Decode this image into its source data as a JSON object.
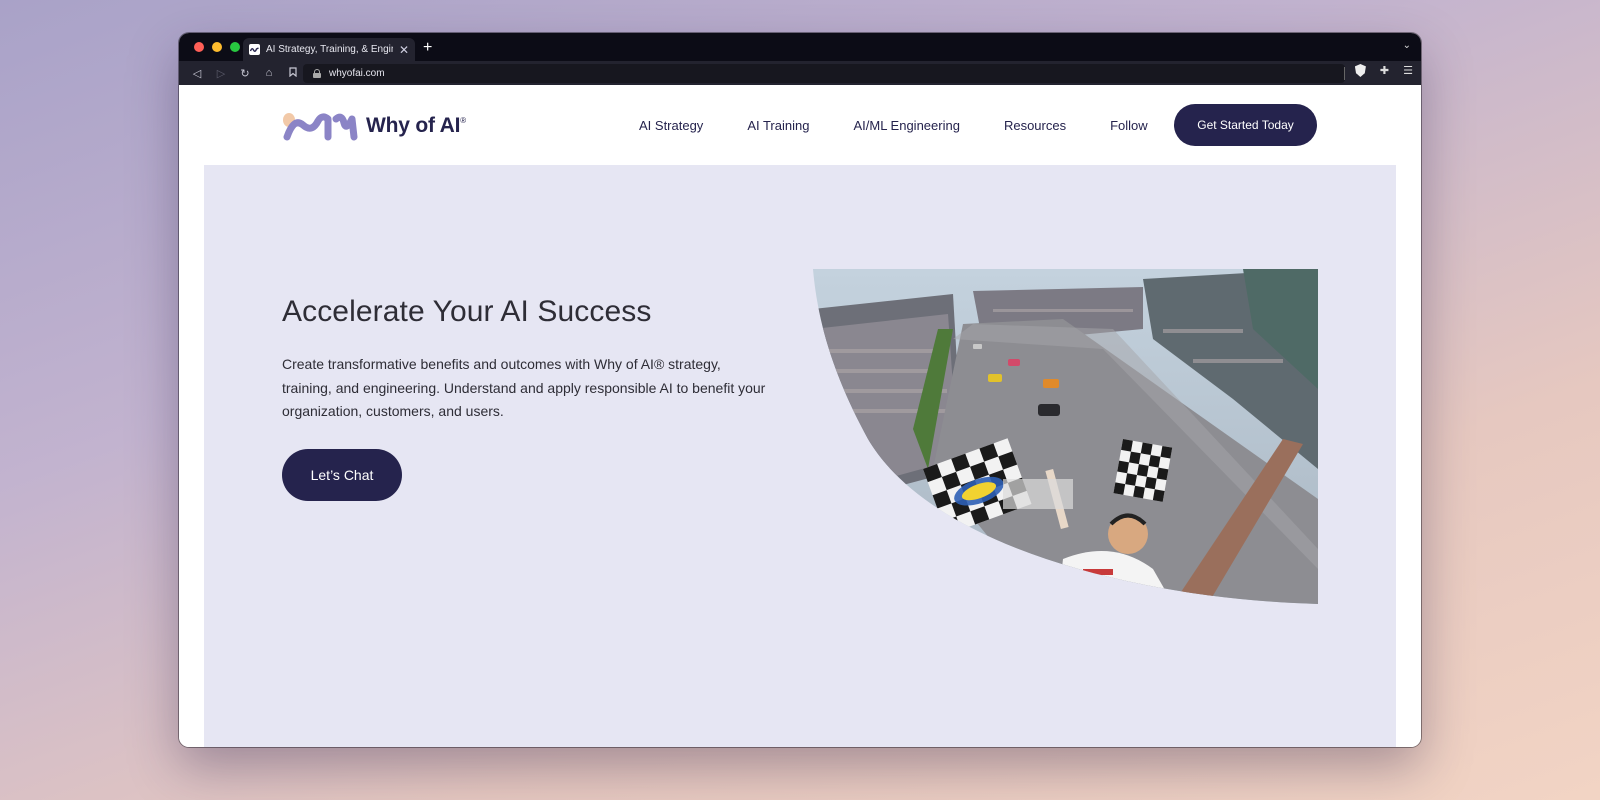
{
  "browser": {
    "tab_title": "AI Strategy, Training, & Engineering",
    "url": "whyofai.com",
    "colors": {
      "close": "#ff5f57",
      "minimize": "#febc2e",
      "maximize": "#28c840"
    }
  },
  "site": {
    "logo_text": "Why of AI",
    "logo_mark": "®",
    "nav": [
      "AI Strategy",
      "AI Training",
      "AI/ML Engineering",
      "Resources",
      "Follow"
    ],
    "cta_top": "Get Started Today"
  },
  "hero": {
    "title": "Accelerate Your AI Success",
    "body": "Create transformative benefits and outcomes with Why of AI® strategy, training, and engineering.  Understand and apply responsible AI to benefit your organization, customers, and users.",
    "cta": "Let’s Chat"
  },
  "theme": {
    "brand_navy": "#25234d",
    "hero_bg": "#e6e6f3",
    "logo_purple": "#8b84c6",
    "logo_peach": "#f2c9a8"
  }
}
